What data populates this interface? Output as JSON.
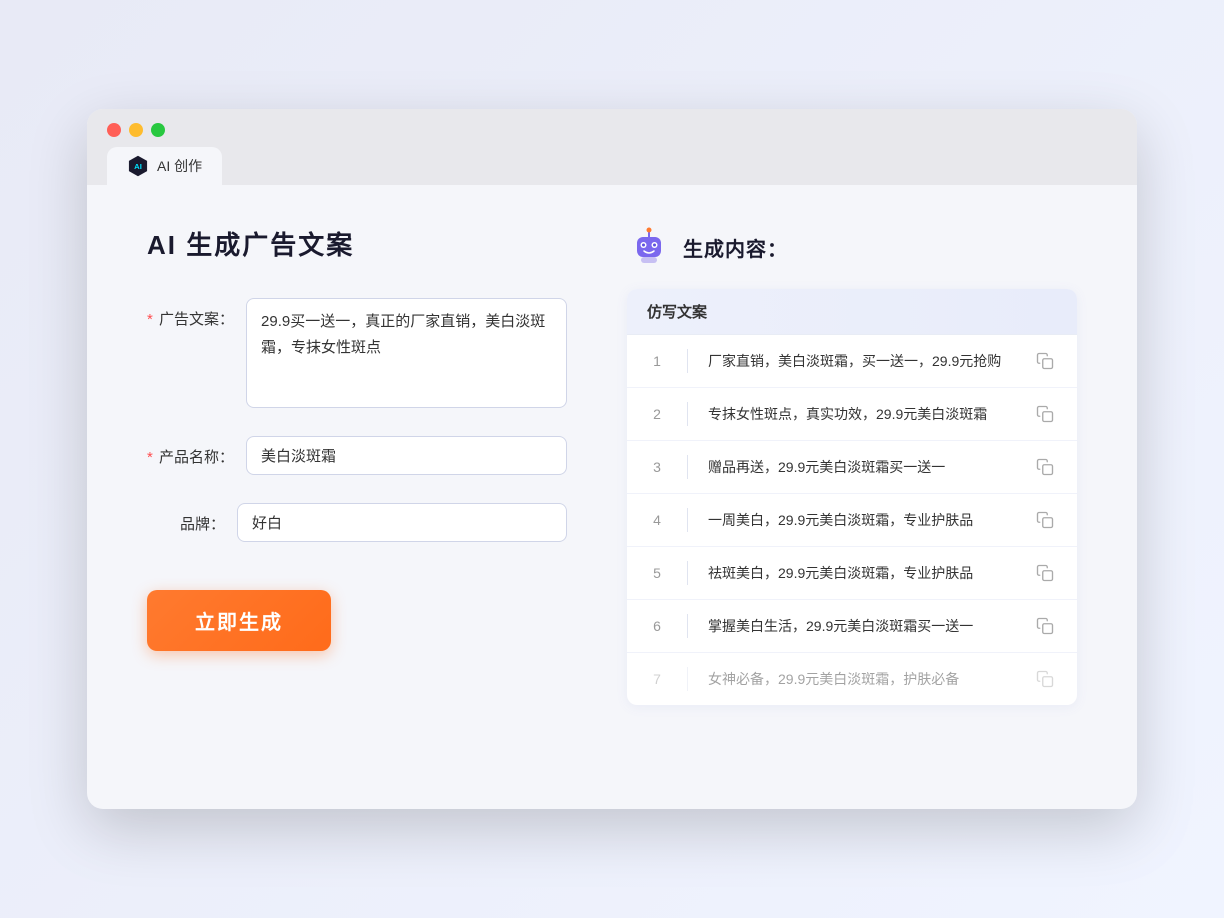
{
  "browser": {
    "tab_label": "AI 创作",
    "traffic_lights": [
      "red",
      "yellow",
      "green"
    ]
  },
  "left": {
    "title": "AI 生成广告文案",
    "fields": [
      {
        "id": "ad_copy",
        "label": "广告文案：",
        "required": true,
        "type": "textarea",
        "value": "29.9买一送一，真正的厂家直销，美白淡斑霜，专抹女性斑点",
        "placeholder": ""
      },
      {
        "id": "product_name",
        "label": "产品名称：",
        "required": true,
        "type": "input",
        "value": "美白淡斑霜",
        "placeholder": ""
      },
      {
        "id": "brand",
        "label": "品牌：",
        "required": false,
        "type": "input",
        "value": "好白",
        "placeholder": ""
      }
    ],
    "generate_btn": "立即生成"
  },
  "right": {
    "title": "生成内容：",
    "table_header": "仿写文案",
    "results": [
      {
        "num": "1",
        "text": "厂家直销，美白淡斑霜，买一送一，29.9元抢购",
        "dimmed": false
      },
      {
        "num": "2",
        "text": "专抹女性斑点，真实功效，29.9元美白淡斑霜",
        "dimmed": false
      },
      {
        "num": "3",
        "text": "赠品再送，29.9元美白淡斑霜买一送一",
        "dimmed": false
      },
      {
        "num": "4",
        "text": "一周美白，29.9元美白淡斑霜，专业护肤品",
        "dimmed": false
      },
      {
        "num": "5",
        "text": "祛斑美白，29.9元美白淡斑霜，专业护肤品",
        "dimmed": false
      },
      {
        "num": "6",
        "text": "掌握美白生活，29.9元美白淡斑霜买一送一",
        "dimmed": false
      },
      {
        "num": "7",
        "text": "女神必备，29.9元美白淡斑霜，护肤必备",
        "dimmed": true
      }
    ]
  }
}
